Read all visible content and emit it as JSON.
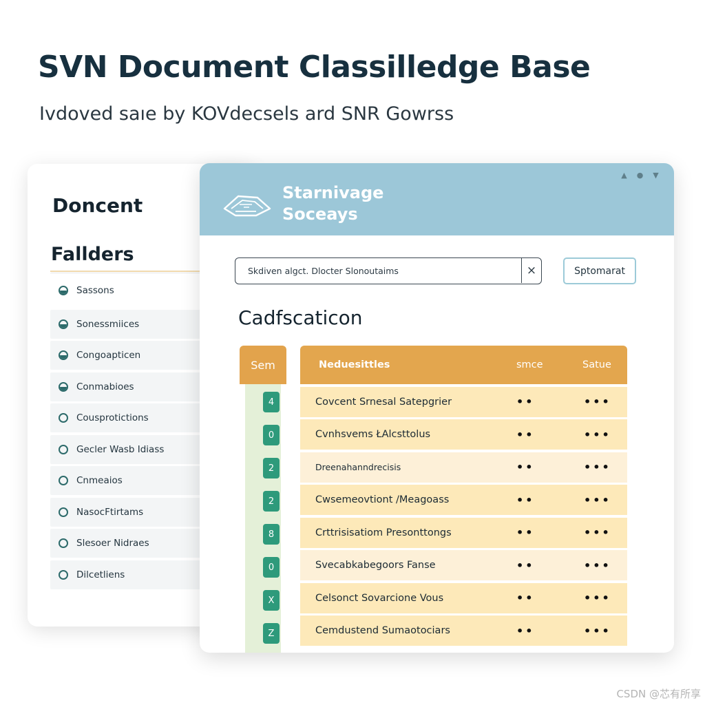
{
  "page": {
    "title": "SVN Document Classilledge Base",
    "subtitle": "Ivdoved saıe by KOVdecsels ard SNR Gowrss"
  },
  "sidebar": {
    "title": "Doncent",
    "folders_title": "Fallders",
    "items": [
      {
        "label": "Sassons"
      },
      {
        "label": "Sonessmiices"
      },
      {
        "label": "Congoapticen"
      },
      {
        "label": "Conmabioes"
      },
      {
        "label": "Cousprotictions"
      },
      {
        "label": "Gecler Wasb Idiass"
      },
      {
        "label": "Cnmeaios"
      },
      {
        "label": "NasocFtirtams"
      },
      {
        "label": "Slesoer Nidraes"
      },
      {
        "label": "Dilcetliens"
      }
    ]
  },
  "header": {
    "brand_line1": "Starnivage",
    "brand_line2": "Soceays"
  },
  "search": {
    "placeholder": "Skdiven algct. Dlocter Slonoutaims",
    "clear_label": "×",
    "button_label": "Sptomarat"
  },
  "main": {
    "section_title": "Cadfscaticon"
  },
  "table": {
    "num_header": "Sem",
    "columns": {
      "name": "Neduesittles",
      "size": "smce",
      "status": "Satue"
    },
    "badges": [
      "4",
      "0",
      "2",
      "2",
      "8",
      "0",
      "X",
      "Z"
    ],
    "rows": [
      {
        "name": "Covcent Srnesal Satepgrier",
        "size": "••",
        "status": "•••"
      },
      {
        "name": "Cvnhsvems ŁAlcsttolus",
        "size": "••",
        "status": "•••"
      },
      {
        "name": "Dreenahanndrecisis",
        "size": "••",
        "status": "•••"
      },
      {
        "name": "Cwsemeovtiont /Meagoass",
        "size": "••",
        "status": "•••"
      },
      {
        "name": "Crttrisisatiom Presonttongs",
        "size": "••",
        "status": "•••"
      },
      {
        "name": "Svecabkabegoors Fanse",
        "size": "••",
        "status": "•••"
      },
      {
        "name": "Celsonct Sovarcione Vous",
        "size": "••",
        "status": "•••"
      },
      {
        "name": "Cemdustend Sumaotociars",
        "size": "••",
        "status": "•••"
      }
    ]
  },
  "watermark": "CSDN @芯有所享",
  "colors": {
    "header_blue": "#9cc7d8",
    "table_orange": "#e3a64e",
    "row_cream": "#fde9b9",
    "badge_green": "#2e9a7b"
  }
}
